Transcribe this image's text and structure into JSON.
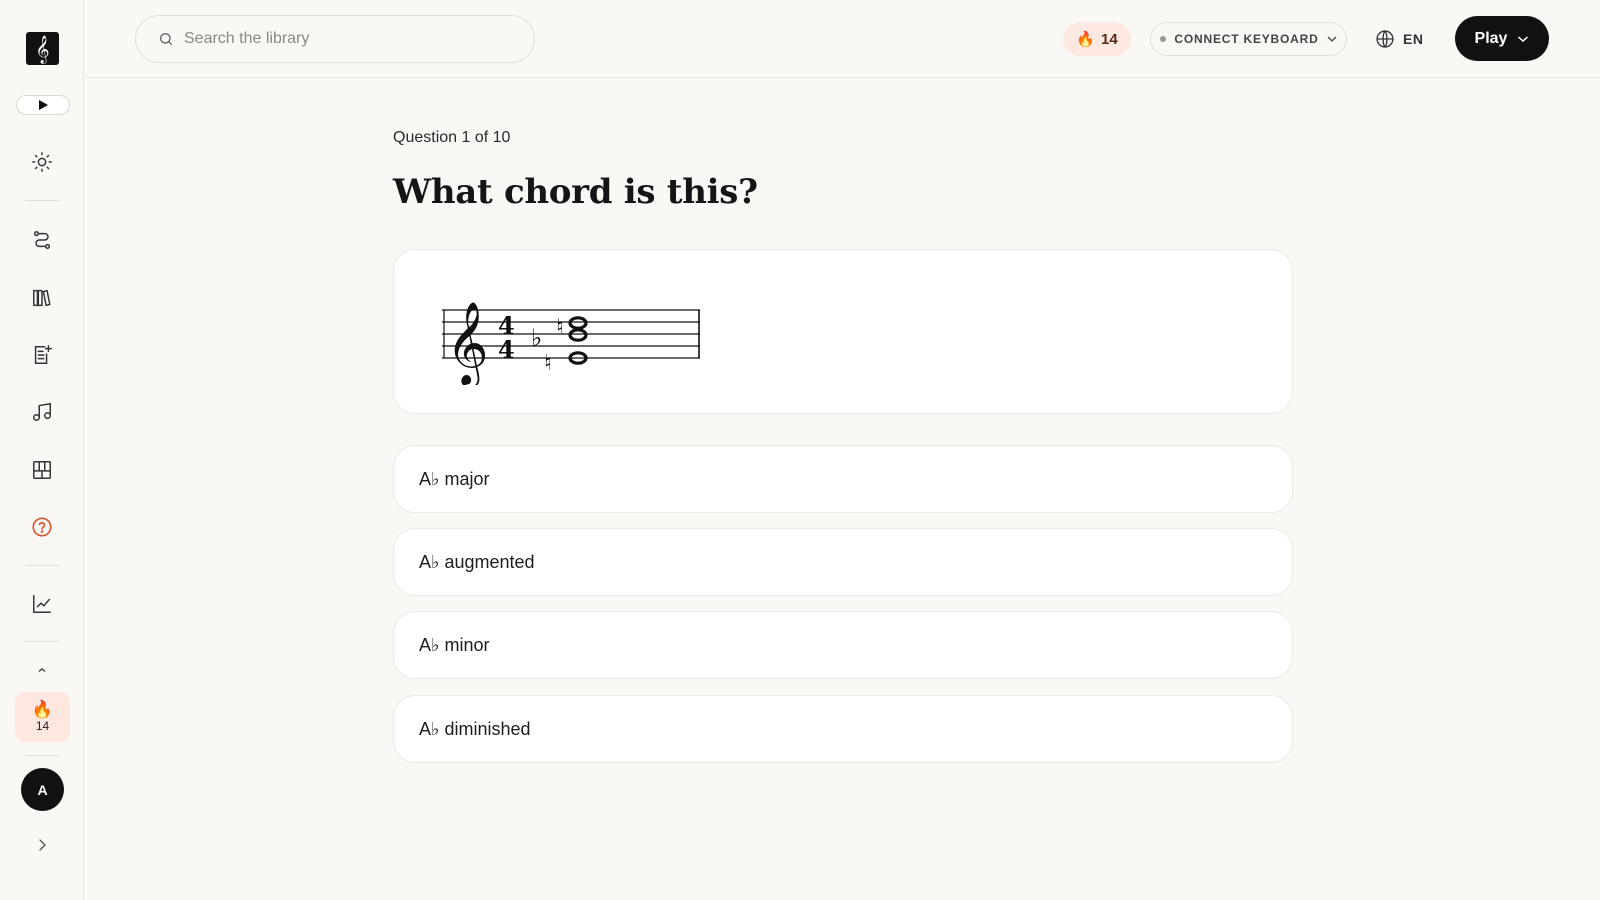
{
  "sidebar": {
    "logo": "𝄞",
    "icons": [
      "play-icon",
      "sun-icon",
      "route-icon",
      "library-icon",
      "worksheet-icon",
      "music-note-icon",
      "piano-icon",
      "help-icon",
      "chart-icon",
      "chevron-up-icon",
      "chevron-right-icon"
    ],
    "streak_count": "14",
    "avatar_initial": "A"
  },
  "header": {
    "search_placeholder": "Search the library",
    "streak_count": "14",
    "keyboard_label": "CONNECT KEYBOARD",
    "language": "EN",
    "play_label": "Play"
  },
  "quiz": {
    "counter": "Question 1 of 10",
    "title": "What chord is this?",
    "options": [
      {
        "label": "A♭ major"
      },
      {
        "label": "A♭ augmented"
      },
      {
        "label": "A♭ minor"
      },
      {
        "label": "A♭ diminished"
      }
    ]
  },
  "colors": {
    "background": "#f9f8f5",
    "accent_dark": "#111111",
    "streak_bg": "#fde9e1",
    "help_icon": "#d9552b"
  }
}
